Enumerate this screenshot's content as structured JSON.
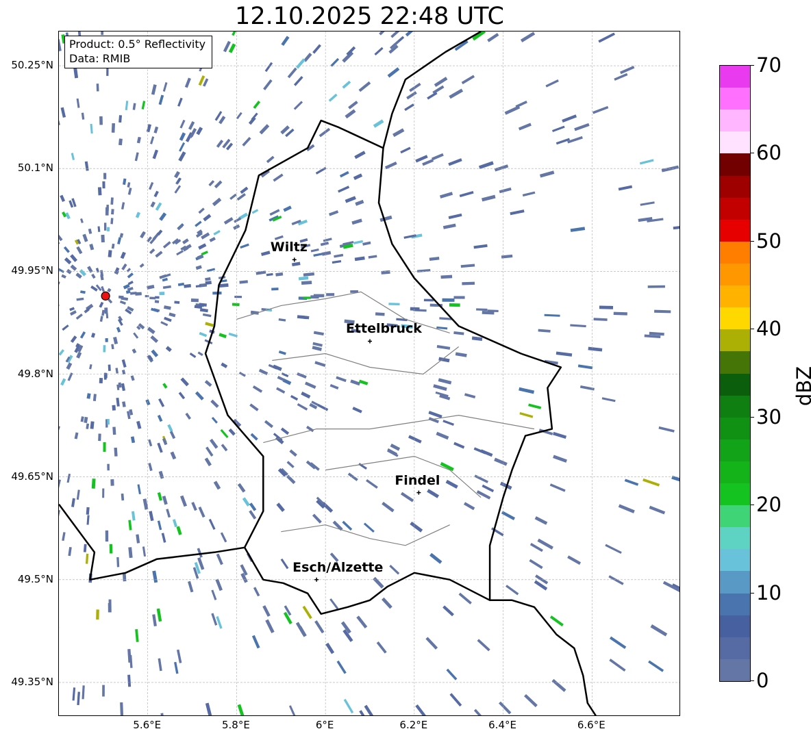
{
  "title": "12.10.2025 22:48 UTC",
  "info": {
    "line1": "Product: 0.5° Reflectivity",
    "line2": "Data: RMIB"
  },
  "map": {
    "lon_range": [
      5.4,
      6.8
    ],
    "lat_range": [
      49.3,
      50.3
    ],
    "lat_ticks": [
      {
        "value": 50.25,
        "label": "50.25°N"
      },
      {
        "value": 50.1,
        "label": "50.1°N"
      },
      {
        "value": 49.95,
        "label": "49.95°N"
      },
      {
        "value": 49.8,
        "label": "49.8°N"
      },
      {
        "value": 49.65,
        "label": "49.65°N"
      },
      {
        "value": 49.5,
        "label": "49.5°N"
      },
      {
        "value": 49.35,
        "label": "49.35°N"
      }
    ],
    "lon_ticks": [
      {
        "value": 5.6,
        "label": "5.6°E"
      },
      {
        "value": 5.8,
        "label": "5.8°E"
      },
      {
        "value": 6.0,
        "label": "6°E"
      },
      {
        "value": 6.2,
        "label": "6.2°E"
      },
      {
        "value": 6.4,
        "label": "6.4°E"
      },
      {
        "value": 6.6,
        "label": "6.6°E"
      }
    ],
    "gridlines": true,
    "radar_site": {
      "lon": 5.505,
      "lat": 49.914
    },
    "cities": [
      {
        "name": "Wiltz",
        "lon": 5.93,
        "lat": 49.967
      },
      {
        "name": "Ettelbruck",
        "lon": 6.1,
        "lat": 49.848
      },
      {
        "name": "Findel",
        "lon": 6.21,
        "lat": 49.627
      },
      {
        "name": "Esch/Alzette",
        "lon": 5.98,
        "lat": 49.5
      }
    ]
  },
  "colorbar": {
    "label": "dBZ",
    "min": 0,
    "max": 70,
    "step": 2.5,
    "tick_labels": [
      "0",
      "10",
      "20",
      "30",
      "40",
      "50",
      "60",
      "70"
    ],
    "colors": [
      "#6376a6",
      "#566ba3",
      "#4760a0",
      "#4a74ae",
      "#5999c5",
      "#68c2da",
      "#5ed3c4",
      "#3fd577",
      "#14c31f",
      "#14b31a",
      "#12a318",
      "#119114",
      "#0f7f12",
      "#0b5e0c",
      "#457507",
      "#adb004",
      "#ffd800",
      "#ffb300",
      "#ff9800",
      "#ff7e00",
      "#e60000",
      "#c20000",
      "#9e0000",
      "#730000",
      "#ffe2ff",
      "#ffb6ff",
      "#ff70ff",
      "#ea3aef"
    ]
  }
}
